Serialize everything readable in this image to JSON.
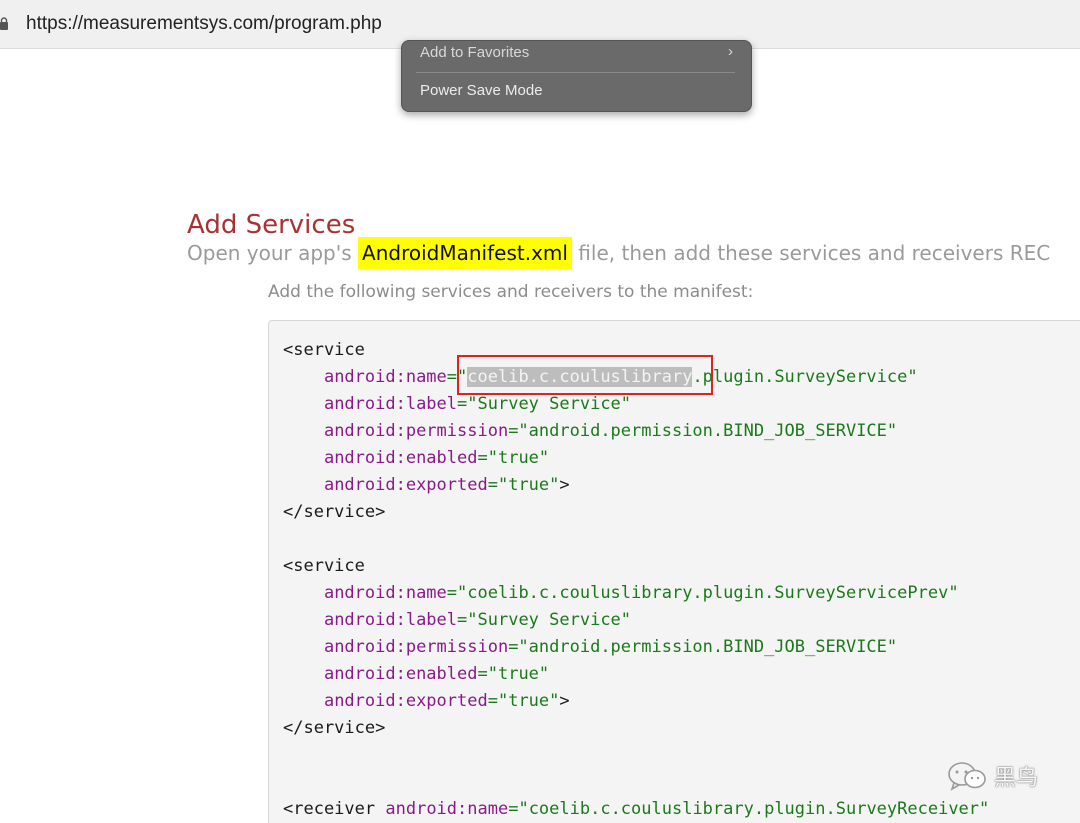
{
  "browser": {
    "url": "https://measurementsys.com/program.php"
  },
  "context_menu": {
    "items": [
      {
        "label": "Add to Favorites",
        "has_submenu": true,
        "submenu_glyph": "›"
      },
      {
        "label": "Power Save Mode"
      }
    ]
  },
  "section": {
    "title": "Add Services",
    "intro_before": "Open your app's ",
    "intro_highlight": "AndroidManifest.xml",
    "intro_after": " file, then add these services and receivers REC",
    "subtext": "Add the following services and receivers to the manifest:"
  },
  "code": {
    "blocks": [
      {
        "open_tag": "<service",
        "attributes": [
          {
            "name": "android:name",
            "value_prefix": "coelib.c.couluslibrary",
            "value_suffix": ".plugin.SurveyService"
          },
          {
            "name": "android:label",
            "value": "Survey Service"
          },
          {
            "name": "android:permission",
            "value": "android.permission.BIND_JOB_SERVICE"
          },
          {
            "name": "android:enabled",
            "value": "true"
          },
          {
            "name": "android:exported",
            "value": "true",
            "closing": ">"
          }
        ],
        "close_tag": "</service>"
      },
      {
        "open_tag": "<service",
        "attributes": [
          {
            "name": "android:name",
            "value": "coelib.c.couluslibrary.plugin.SurveyServicePrev"
          },
          {
            "name": "android:label",
            "value": "Survey Service"
          },
          {
            "name": "android:permission",
            "value": "android.permission.BIND_JOB_SERVICE"
          },
          {
            "name": "android:enabled",
            "value": "true"
          },
          {
            "name": "android:exported",
            "value": "true",
            "closing": ">"
          }
        ],
        "close_tag": "</service>"
      },
      {
        "open_tag": "<receiver",
        "attributes": [
          {
            "name": "android:name",
            "value": "coelib.c.couluslibrary.plugin.SurveyReceiver"
          }
        ]
      }
    ],
    "highlighted_text": "coelib.c.couluslibrary"
  },
  "watermark": {
    "text": "黑鸟",
    "icon": "wechat-icon"
  },
  "colors": {
    "title_red": "#a83232",
    "highlight_yellow": "#ffff00",
    "annotation_red": "#e0211f",
    "xml_attr": "#8a1a8a",
    "xml_value": "#1a7a1a"
  }
}
